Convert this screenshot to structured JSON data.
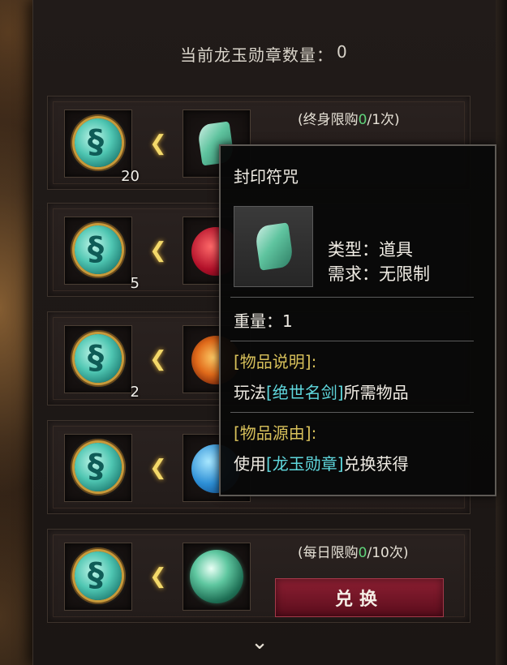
{
  "header": {
    "count_label": "当前龙玉勋章数量：",
    "count_value": "0"
  },
  "rows": [
    {
      "cost_qty": "20",
      "limit_prefix": "(终身限购",
      "limit_used": "0",
      "limit_suffix": "/1次)"
    },
    {
      "cost_qty": "5"
    },
    {
      "cost_qty": "2"
    },
    {
      "cost_qty": ""
    },
    {
      "cost_qty": "",
      "limit_prefix": "(每日限购",
      "limit_used": "0",
      "limit_suffix": "/10次)",
      "button_label": "兑换"
    }
  ],
  "tooltip": {
    "title": "封印符咒",
    "type_label": "类型：",
    "type_value": "道具",
    "req_label": "需求：",
    "req_value": "无限制",
    "weight_label": "重量：",
    "weight_value": "1",
    "desc_header": "[物品说明]:",
    "desc_pre": "玩法",
    "desc_link": "[绝世名剑]",
    "desc_post": "所需物品",
    "src_header": "[物品源由]:",
    "src_pre": "使用",
    "src_link": "[龙玉勋章]",
    "src_post": "兑换获得"
  },
  "icons": {
    "cost": "dragon-jade-medal-icon",
    "arrow": "chevron-left-icon",
    "scroll": "chevron-down-icon"
  },
  "colors": {
    "accent_green": "#5fd37a",
    "link_cyan": "#5fd7dd",
    "header_gold": "#d7c05a",
    "button_red": "#8c1f32"
  }
}
